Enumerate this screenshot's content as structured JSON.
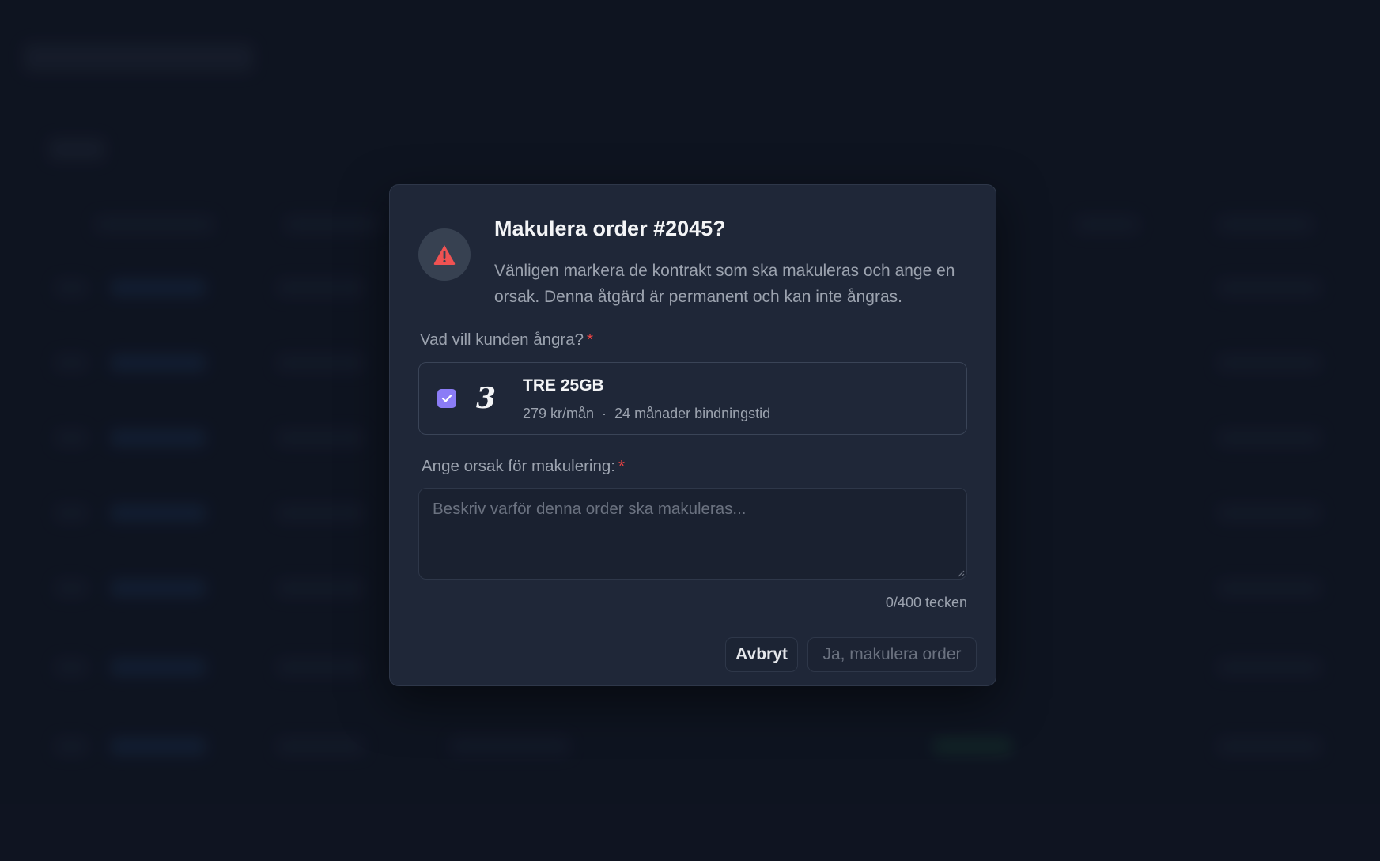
{
  "dialog": {
    "title": "Makulera order #2045?",
    "description": "Vänligen markera de kontrakt som ska makuleras och ange en orsak. Denna åtgärd är permanent och kan inte ångras.",
    "contracts_label": "Vad vill kunden ångra?",
    "required_marker": "*",
    "contract": {
      "name": "TRE 25GB",
      "price": "279 kr/mån",
      "separator": "·",
      "binding": "24 månader bindningstid",
      "checked": true,
      "logo_glyph": "3",
      "logo_icon": "tre-logo-icon"
    },
    "reason_label": "Ange orsak för makulering:",
    "reason_placeholder": "Beskriv varför denna order ska makuleras...",
    "reason_value": "",
    "counter": "0/400 tecken",
    "cancel_label": "Avbryt",
    "confirm_label": "Ja, makulera order"
  },
  "colors": {
    "accent": "#8b7cf6",
    "danger": "#ef4444",
    "modal_bg": "#1f2738",
    "page_bg": "#121826"
  }
}
